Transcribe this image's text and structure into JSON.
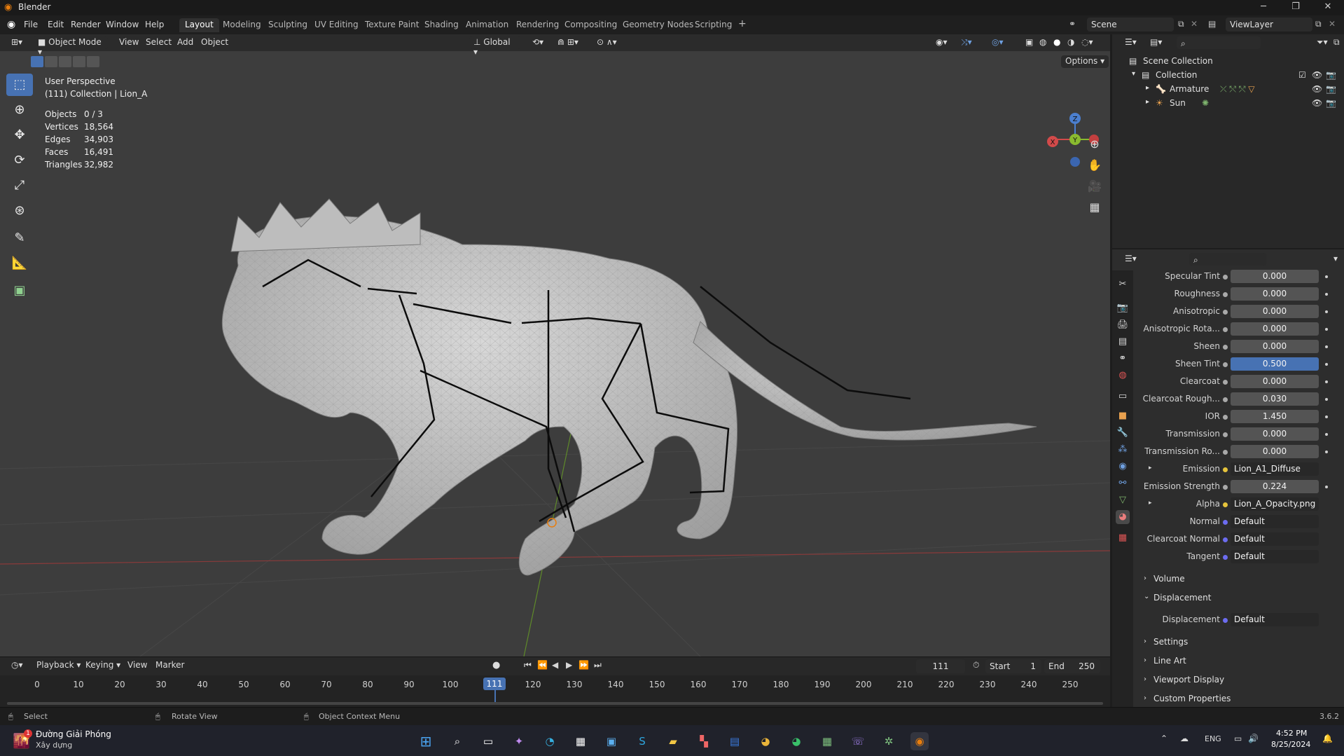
{
  "window": {
    "title": "Blender"
  },
  "menu": [
    "File",
    "Edit",
    "Render",
    "Window",
    "Help"
  ],
  "workspaces": [
    "Layout",
    "Modeling",
    "Sculpting",
    "UV Editing",
    "Texture Paint",
    "Shading",
    "Animation",
    "Rendering",
    "Compositing",
    "Geometry Nodes",
    "Scripting"
  ],
  "active_workspace": "Layout",
  "scene_name": "Scene",
  "view_layer": "ViewLayer",
  "viewport_header": {
    "mode": "Object Mode",
    "menus": [
      "View",
      "Select",
      "Add",
      "Object"
    ],
    "orientation": "Global",
    "options": "Options"
  },
  "viewport_info": {
    "perspective": "User Perspective",
    "collection": "(111) Collection | Lion_A"
  },
  "stats": [
    {
      "label": "Objects",
      "value": "0 / 3"
    },
    {
      "label": "Vertices",
      "value": "18,564"
    },
    {
      "label": "Edges",
      "value": "34,903"
    },
    {
      "label": "Faces",
      "value": "16,491"
    },
    {
      "label": "Triangles",
      "value": "32,982"
    }
  ],
  "gizmo": {
    "x": "X",
    "y": "Y",
    "z": "Z"
  },
  "outliner": {
    "root": "Scene Collection",
    "collection": "Collection",
    "items": [
      "Armature",
      "Sun"
    ]
  },
  "properties": [
    {
      "label": "Specular Tint",
      "value": "0.000"
    },
    {
      "label": "Roughness",
      "value": "0.000"
    },
    {
      "label": "Anisotropic",
      "value": "0.000"
    },
    {
      "label": "Anisotropic Rota...",
      "value": "0.000"
    },
    {
      "label": "Sheen",
      "value": "0.000"
    },
    {
      "label": "Sheen Tint",
      "value": "0.500"
    },
    {
      "label": "Clearcoat",
      "value": "0.000"
    },
    {
      "label": "Clearcoat Rough...",
      "value": "0.030"
    },
    {
      "label": "IOR",
      "value": "1.450"
    },
    {
      "label": "Transmission",
      "value": "0.000"
    },
    {
      "label": "Transmission Ro...",
      "value": "0.000"
    },
    {
      "label": "Emission",
      "value": "Lion_A1_Diffuse"
    },
    {
      "label": "Emission Strength",
      "value": "0.224"
    },
    {
      "label": "Alpha",
      "value": "Lion_A_Opacity.png"
    },
    {
      "label": "Normal",
      "value": "Default"
    },
    {
      "label": "Clearcoat Normal",
      "value": "Default"
    },
    {
      "label": "Tangent",
      "value": "Default"
    }
  ],
  "panels": {
    "volume": "Volume",
    "displacement": "Displacement",
    "displacement_label": "Displacement",
    "displacement_value": "Default",
    "settings": "Settings",
    "line_art": "Line Art",
    "viewport_display": "Viewport Display",
    "custom_properties": "Custom Properties"
  },
  "timeline": {
    "menus": [
      "Playback",
      "Keying",
      "View",
      "Marker"
    ],
    "current_frame": "111",
    "start_label": "Start",
    "start": "1",
    "end_label": "End",
    "end": "250",
    "ticks": [
      "0",
      "10",
      "20",
      "30",
      "40",
      "50",
      "60",
      "70",
      "80",
      "90",
      "100",
      "111",
      "120",
      "130",
      "140",
      "150",
      "160",
      "170",
      "180",
      "190",
      "200",
      "210",
      "220",
      "230",
      "240",
      "250"
    ]
  },
  "status": {
    "select": "Select",
    "rotate": "Rotate View",
    "context": "Object Context Menu",
    "version": "3.6.2"
  },
  "taskbar": {
    "weather_title": "Đường Giải Phóng",
    "weather_sub": "Xây dựng",
    "weather_badge": "1",
    "lang": "ENG",
    "time": "4:52 PM",
    "date": "8/25/2024"
  },
  "colors": {
    "accent": "#4772b3",
    "viewport_bg": "#3d3d3d",
    "panel_bg": "#2d2d2d"
  }
}
